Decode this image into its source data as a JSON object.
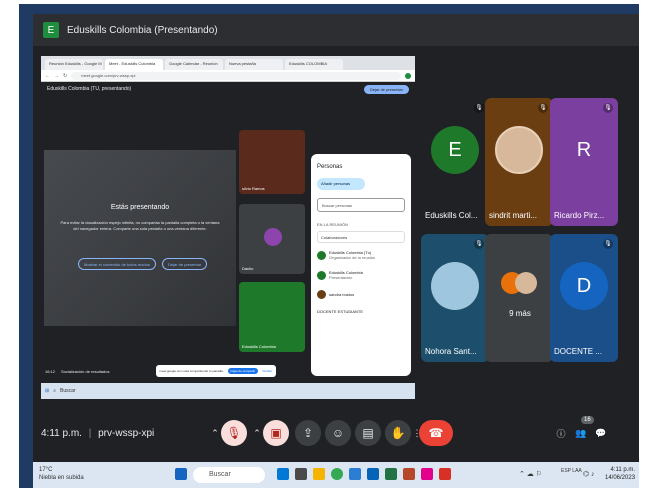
{
  "window_title": "Eduskills Colombia (Presentando)",
  "title_badge": "E",
  "shared_screen": {
    "tabs": [
      "Reunión Eduskills - Google M",
      "Meet - Eduskills Colombia",
      "Google Calendar - Reunión",
      "Nueva pestaña",
      "Eduskills COLOMBIA"
    ],
    "address": "meet.google.com/prv-wssp-xpi",
    "inner_title": "Eduskills Colombia (TU, presentando)",
    "stop_label": "Dejar de presentar",
    "presenting_title": "Estás presentando",
    "presenting_text": "Para evitar la visualización espejo infinita, no compartas la pantalla completa o la ventana del navegador entera. Comparte una sola pestaña o una ventana diferente.",
    "btn_show": "Mostrar el contenido de todos modos",
    "btn_stop": "Dejar de presentar",
    "tile_names": [
      "silvio Ramos",
      "Danilo",
      "Eduskills Colombia"
    ],
    "people_panel": {
      "header": "Personas",
      "add_label": "Añadir personas",
      "search_placeholder": "Buscar personas",
      "section": "EN LA REUNIÓN",
      "contributors": "Colaboradores",
      "rows": [
        {
          "name": "Eduskills Colombia (Tú)",
          "sub": "Organizador de la reunión"
        },
        {
          "name": "Eduskills Colombia",
          "sub": "Presentación"
        },
        {
          "name": "sandra bustos",
          "sub": ""
        },
        {
          "name": "DOCENTE ESTUDIANTE",
          "sub": ""
        }
      ]
    },
    "bottom_time": "16:12",
    "bottom_text": "Socialización de resultados",
    "share_notice": "meet.google.com está compartiendo tu pantalla.",
    "share_stop": "Dejar de compartir",
    "share_hide": "Ocultar",
    "taskbar_search": "Buscar"
  },
  "participants": [
    {
      "name": "Eduskills Col...",
      "initial": "E",
      "bg": "#1e7a2a",
      "circle": "#1e7a2a"
    },
    {
      "name": "sindrit marti...",
      "initial": "",
      "bg": "#6b3e12",
      "circle": "#d8b89a"
    },
    {
      "name": "Ricardo Pirz...",
      "initial": "R",
      "bg": "#7b3fa0",
      "circle": "#7b3fa0"
    },
    {
      "name": "Nohora Sant...",
      "initial": "",
      "bg": "#1d4e6b",
      "circle": "#9fc6df"
    },
    {
      "name": "9 más",
      "initial": "",
      "bg": "#3c4043",
      "circle": "#3c4043"
    },
    {
      "name": "DOCENTE ...",
      "initial": "D",
      "bg": "#1a4f8a",
      "circle": "#1565c0"
    }
  ],
  "controls": {
    "time": "4:11 p.m.",
    "meeting_code": "prv-wssp-xpi",
    "participants_count": "16"
  },
  "taskbar": {
    "weather_temp": "17°C",
    "weather_desc": "Niebla en subida",
    "search": "Buscar",
    "clock_time": "4:11 p.m.",
    "clock_date": "14/06/2023",
    "lang": "ESP LAA"
  }
}
